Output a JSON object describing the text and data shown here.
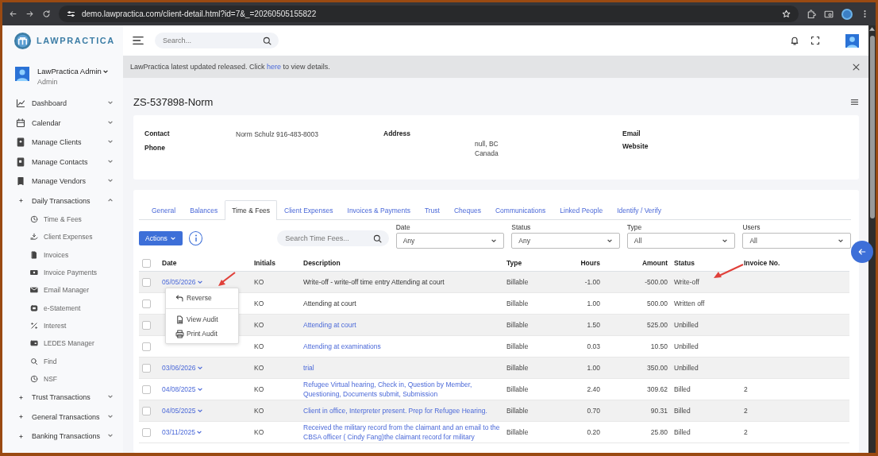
{
  "browser": {
    "url": "demo.lawpractica.com/client-detail.html?id=7&_=20260505155822"
  },
  "logo": {
    "text": "LAWPRACTICA"
  },
  "header": {
    "search_placeholder": "Search..."
  },
  "user": {
    "name": "LawPractica Admin",
    "role": "Admin"
  },
  "sidebar": {
    "items": [
      {
        "label": "Dashboard",
        "kind": "page",
        "expanded": false
      },
      {
        "label": "Calendar",
        "kind": "page",
        "expanded": false
      },
      {
        "label": "Manage Clients",
        "kind": "page",
        "expanded": false
      },
      {
        "label": "Manage Contacts",
        "kind": "page",
        "expanded": false
      },
      {
        "label": "Manage Vendors",
        "kind": "page",
        "expanded": false
      },
      {
        "label": "Daily Transactions",
        "kind": "group",
        "expanded": true,
        "children": [
          {
            "label": "Time & Fees"
          },
          {
            "label": "Client Expenses"
          },
          {
            "label": "Invoices"
          },
          {
            "label": "Invoice Payments"
          },
          {
            "label": "Email Manager"
          },
          {
            "label": "e-Statement"
          },
          {
            "label": "Interest"
          },
          {
            "label": "LEDES Manager"
          },
          {
            "label": "Find"
          },
          {
            "label": "NSF"
          }
        ]
      },
      {
        "label": "Trust Transactions",
        "kind": "group",
        "expanded": false
      },
      {
        "label": "General Transactions",
        "kind": "group",
        "expanded": false
      },
      {
        "label": "Banking Transactions",
        "kind": "group",
        "expanded": false
      }
    ]
  },
  "banner": {
    "text": "LawPractica latest updated released. Click ",
    "link": "here",
    "after": " to view details."
  },
  "page_title": "ZS-537898-Norm",
  "contact_card": {
    "columns": [
      {
        "fields": [
          {
            "label": "Contact",
            "lines": [
              "Norm Schulz 916-483-8003"
            ]
          },
          {
            "label": "Phone"
          }
        ]
      },
      {
        "fields": [
          {
            "label": "Address",
            "lines": [
              "null, BC",
              "Canada"
            ],
            "below": true
          }
        ]
      },
      {
        "fields": [
          {
            "label": "Email"
          },
          {
            "label": "Website"
          }
        ]
      }
    ]
  },
  "tabs": [
    {
      "label": "General",
      "selected": false
    },
    {
      "label": "Balances",
      "selected": false
    },
    {
      "label": "Time & Fees",
      "selected": true
    },
    {
      "label": "Client Expenses",
      "selected": false
    },
    {
      "label": "Invoices & Payments",
      "selected": false
    },
    {
      "label": "Trust",
      "selected": false
    },
    {
      "label": "Cheques",
      "selected": false
    },
    {
      "label": "Communications",
      "selected": false
    },
    {
      "label": "Linked People",
      "selected": false
    },
    {
      "label": "Identify / Verify",
      "selected": false
    }
  ],
  "toolbar": {
    "actions": "Actions",
    "search_placeholder": "Search Time Fees..."
  },
  "filters": [
    {
      "label": "Date",
      "value": "Any"
    },
    {
      "label": "Status",
      "value": "Any"
    },
    {
      "label": "Type",
      "value": "All"
    },
    {
      "label": "Users",
      "value": "All"
    }
  ],
  "table": {
    "all_checked": false,
    "columns": [
      "Date",
      "Initials",
      "Description",
      "Type",
      "Hours",
      "Amount",
      "Status",
      "Invoice No."
    ],
    "rows": [
      {
        "checked": false,
        "date": "05/05/2026",
        "initials": "KO",
        "description": "Write-off - write-off time entry Attending at court",
        "linked": false,
        "type": "Billable",
        "hours": "-1.00",
        "amount": "-500.00",
        "status": "Write-off"
      },
      {
        "checked": false,
        "initials": "KO",
        "description": "Attending at court",
        "linked": false,
        "type": "Billable",
        "hours": "1.00",
        "amount": "500.00",
        "status": "Written off"
      },
      {
        "checked": false,
        "initials": "KO",
        "description": "Attending at court",
        "linked": true,
        "type": "Billable",
        "hours": "1.50",
        "amount": "525.00",
        "status": "Unbilled"
      },
      {
        "checked": false,
        "initials": "KO",
        "description": "Attending at examinations",
        "linked": true,
        "type": "Billable",
        "hours": "0.03",
        "amount": "10.50",
        "status": "Unbilled"
      },
      {
        "checked": false,
        "date": "03/06/2026",
        "initials": "KO",
        "description": "trial",
        "linked": true,
        "type": "Billable",
        "hours": "1.00",
        "amount": "350.00",
        "status": "Unbilled"
      },
      {
        "checked": false,
        "date": "04/08/2025",
        "initials": "KO",
        "description": "Refugee Virtual hearing, Check in, Question by Member, Questioning, Documents submit, Submission",
        "linked": true,
        "type": "Billable",
        "hours": "2.40",
        "amount": "309.62",
        "status": "Billed",
        "invoice": "2"
      },
      {
        "checked": false,
        "date": "04/05/2025",
        "initials": "KO",
        "description": "Client in office, Interpreter present. Prep for Refugee Hearing.",
        "linked": true,
        "type": "Billable",
        "hours": "0.70",
        "amount": "90.31",
        "status": "Billed",
        "invoice": "2"
      },
      {
        "checked": false,
        "date": "03/11/2025",
        "initials": "KO",
        "description": "Received the military record from the claimant and an email to the CBSA officer ( Cindy Fang)the claimant record for military",
        "linked": true,
        "type": "Billable",
        "hours": "0.20",
        "amount": "25.80",
        "status": "Billed",
        "invoice": "2"
      }
    ]
  },
  "row_menu": {
    "items": [
      {
        "label": "Reverse",
        "kind": "undo"
      },
      {
        "label": "View Audit",
        "kind": "doc"
      },
      {
        "label": "Print Audit",
        "kind": "print"
      }
    ]
  }
}
